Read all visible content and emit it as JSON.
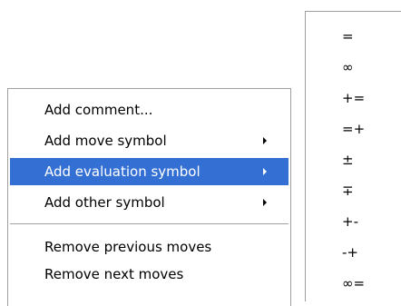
{
  "context_menu": {
    "items": [
      {
        "label": "Add comment...",
        "has_submenu": false
      },
      {
        "label": "Add move symbol",
        "has_submenu": true
      },
      {
        "label": "Add evaluation symbol",
        "has_submenu": true,
        "highlighted": true
      },
      {
        "label": "Add other symbol",
        "has_submenu": true
      },
      {
        "label": "Remove previous moves",
        "has_submenu": false
      },
      {
        "label": "Remove next moves",
        "has_submenu": false
      }
    ]
  },
  "evaluation_submenu": {
    "items": [
      "=",
      "∞",
      "+=",
      "=+",
      "±",
      "∓",
      "+-",
      "-+",
      "∞="
    ]
  },
  "colors": {
    "highlight": "#3470d3",
    "highlight_text": "#ffffff",
    "border": "#9f9f9f"
  }
}
